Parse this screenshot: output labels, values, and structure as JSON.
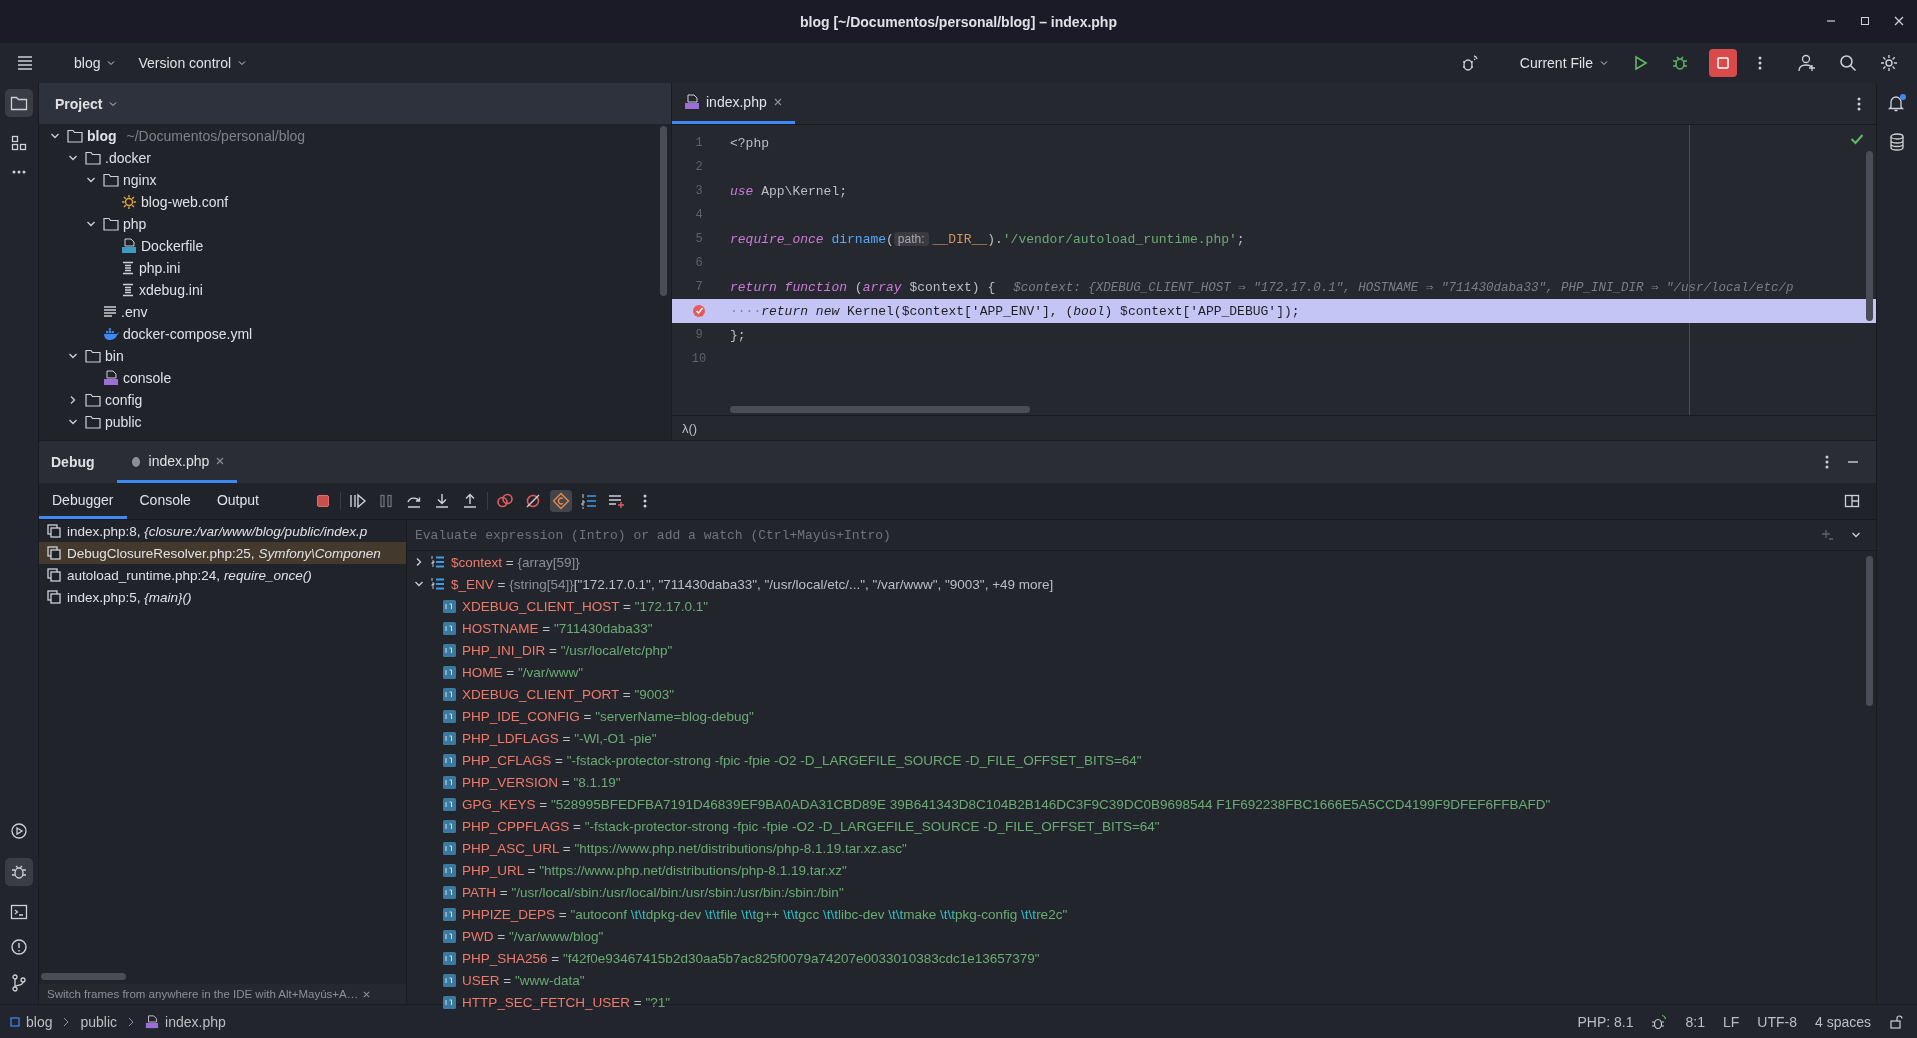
{
  "window": {
    "title": "blog [~/Documentos/personal/blog] – index.php"
  },
  "toolbar": {
    "project": "blog",
    "vcs": "Version control",
    "run_config": "Current File"
  },
  "project": {
    "title": "Project",
    "tree": [
      {
        "label": "blog",
        "path": "~/Documentos/personal/blog",
        "kind": "folder",
        "expanded": true,
        "children": [
          {
            "label": ".docker",
            "kind": "folder",
            "expanded": true,
            "children": [
              {
                "label": "nginx",
                "kind": "folder",
                "expanded": true,
                "children": [
                  {
                    "label": "blog-web.conf",
                    "kind": "config"
                  }
                ]
              },
              {
                "label": "php",
                "kind": "folder",
                "expanded": true,
                "children": [
                  {
                    "label": "Dockerfile",
                    "kind": "dockerfile"
                  },
                  {
                    "label": "php.ini",
                    "kind": "ini"
                  },
                  {
                    "label": "xdebug.ini",
                    "kind": "ini"
                  }
                ]
              },
              {
                "label": ".env",
                "kind": "text"
              },
              {
                "label": "docker-compose.yml",
                "kind": "compose"
              }
            ]
          },
          {
            "label": "bin",
            "kind": "folder",
            "expanded": true,
            "children": [
              {
                "label": "console",
                "kind": "php"
              }
            ]
          },
          {
            "label": "config",
            "kind": "folder",
            "expanded": false
          },
          {
            "label": "public",
            "kind": "folder",
            "expanded": true
          }
        ]
      }
    ]
  },
  "editor": {
    "tabs": [
      {
        "label": "index.php",
        "selected": true
      }
    ],
    "lines": [
      {
        "number": "1",
        "current": false,
        "breakpoint": false,
        "tokens": [
          {
            "kind": "plain",
            "text": "<?php"
          }
        ]
      },
      {
        "number": "2",
        "current": false,
        "breakpoint": false
      },
      {
        "number": "3",
        "current": false,
        "breakpoint": false,
        "tokens": [
          {
            "kind": "kw",
            "text": "use"
          },
          {
            "kind": "plain",
            "text": " App\\Kernel;"
          }
        ]
      },
      {
        "number": "4",
        "current": false,
        "breakpoint": false
      },
      {
        "number": "5",
        "current": false,
        "breakpoint": false,
        "tokens": [
          {
            "kind": "kw",
            "text": "require_once"
          },
          {
            "kind": "fn",
            "text": " dirname"
          },
          {
            "kind": "plain",
            "text": "("
          },
          {
            "kind": "hint",
            "text": "path:"
          },
          {
            "kind": "const",
            "text": "__DIR__"
          },
          {
            "kind": "plain",
            "text": ")."
          },
          {
            "kind": "str",
            "text": "'/vendor/autoload_runtime.php'"
          },
          {
            "kind": "plain",
            "text": ";"
          }
        ]
      },
      {
        "number": "6",
        "current": false,
        "breakpoint": false
      },
      {
        "number": "7",
        "current": false,
        "breakpoint": false,
        "tokens": [
          {
            "kind": "kw",
            "text": "return function"
          },
          {
            "kind": "plain",
            "text": " ("
          },
          {
            "kind": "kw",
            "text": "array"
          },
          {
            "kind": "plain",
            "text": " $context) {"
          },
          {
            "kind": "inline",
            "text": "$context: {XDEBUG_CLIENT_HOST ⇒ \"172.17.0.1\", HOSTNAME ⇒ \"711430daba33\", PHP_INI_DIR ⇒ \"/usr/local/etc/p"
          }
        ]
      },
      {
        "current": true,
        "breakpoint": true,
        "tokens": [
          {
            "kind": "ws",
            "text": "····"
          },
          {
            "kind": "kw",
            "text": "return new"
          },
          {
            "kind": "plain",
            "text": " Kernel($context['APP_ENV'], ("
          },
          {
            "kind": "kw",
            "text": "bool"
          },
          {
            "kind": "plain",
            "text": ") $context['APP_DEBUG']);"
          }
        ]
      },
      {
        "number": "9",
        "current": false,
        "breakpoint": false,
        "tokens": [
          {
            "kind": "plain",
            "text": "};"
          }
        ]
      },
      {
        "number": "10",
        "current": false,
        "breakpoint": false
      }
    ],
    "breadcrumb": "λ()"
  },
  "debug": {
    "title": "Debug",
    "tabs": [
      {
        "label": "index.php",
        "selected": true
      }
    ],
    "subtabs": [
      {
        "label": "Debugger",
        "selected": true
      },
      {
        "label": "Console",
        "selected": false
      },
      {
        "label": "Output",
        "selected": false
      }
    ],
    "actions": [
      {
        "kind": "stop",
        "on": false
      },
      {
        "kind": "resume",
        "on": false
      },
      {
        "kind": "pause",
        "on": false
      },
      {
        "kind": "step-over",
        "on": false
      },
      {
        "kind": "step-into",
        "on": false
      },
      {
        "kind": "step-out",
        "on": false
      },
      {
        "kind": "breakpoints",
        "on": false
      },
      {
        "kind": "mute",
        "on": false
      },
      {
        "kind": "exceptions",
        "on": true
      },
      {
        "kind": "frames",
        "on": false
      },
      {
        "kind": "watch",
        "on": false
      },
      {
        "kind": "more",
        "on": false
      }
    ],
    "frames": [
      {
        "text": "index.php:8, *{closure:/var/www/blog/public/index.p*",
        "selected": false
      },
      {
        "text": "DebugClosureResolver.php:25, *Symfony\\Componen*",
        "selected": true
      },
      {
        "text": "autoload_runtime.php:24, *require_once()*",
        "selected": false
      },
      {
        "text": "index.php:5, *{main}()*",
        "selected": false
      }
    ],
    "hint": "Switch frames from anywhere in the IDE with Alt+Mayús+A…",
    "evaluate": {
      "placeholder": "Evaluate expression (Intro) or add a watch (Ctrl+Mayús+Intro)"
    },
    "variables": [
      {
        "name": "$context",
        "op": "=",
        "type": "{array[59]}",
        "expanded": false
      },
      {
        "name": "$_ENV",
        "op": "=",
        "type": "{string[54]}",
        "value": "[\"172.17.0.1\", \"711430daba33\", \"/usr/local/etc/...\", \"/var/www\", \"9003\", +49 more]",
        "expanded": true,
        "children": [
          {
            "name": "XDEBUG_CLIENT_HOST",
            "op": "=",
            "value": "\"172.17.0.1\""
          },
          {
            "name": "HOSTNAME",
            "op": "=",
            "value": "\"711430daba33\""
          },
          {
            "name": "PHP_INI_DIR",
            "op": "=",
            "value": "\"/usr/local/etc/php\""
          },
          {
            "name": "HOME",
            "op": "=",
            "value": "\"/var/www\""
          },
          {
            "name": "XDEBUG_CLIENT_PORT",
            "op": "=",
            "value": "\"9003\""
          },
          {
            "name": "PHP_IDE_CONFIG",
            "op": "=",
            "value": "\"serverName=blog-debug\""
          },
          {
            "name": "PHP_LDFLAGS",
            "op": "=",
            "value": "\"-Wl,-O1 -pie\""
          },
          {
            "name": "PHP_CFLAGS",
            "op": "=",
            "value": "\"-fstack-protector-strong -fpic -fpie -O2 -D_LARGEFILE_SOURCE -D_FILE_OFFSET_BITS=64\""
          },
          {
            "name": "PHP_VERSION",
            "op": "=",
            "value": "\"8.1.19\""
          },
          {
            "name": "GPG_KEYS",
            "op": "=",
            "value": "\"528995BFEDFBA7191D46839EF9BA0ADA31CBD89E 39B641343D8C104B2B146DC3F9C39DC0B9698544 F1F692238FBC1666E5A5CCD4199F9DFEF6FFBAFD\""
          },
          {
            "name": "PHP_CPPFLAGS",
            "op": "=",
            "value": "\"-fstack-protector-strong -fpic -fpie -O2 -D_LARGEFILE_SOURCE -D_FILE_OFFSET_BITS=64\""
          },
          {
            "name": "PHP_ASC_URL",
            "op": "=",
            "value": "\"https://www.php.net/distributions/php-8.1.19.tar.xz.asc\""
          },
          {
            "name": "PHP_URL",
            "op": "=",
            "value": "\"https://www.php.net/distributions/php-8.1.19.tar.xz\""
          },
          {
            "name": "PATH",
            "op": "=",
            "value": "\"/usr/local/sbin:/usr/local/bin:/usr/sbin:/usr/bin:/sbin:/bin\""
          },
          {
            "name": "PHPIZE_DEPS",
            "op": "=",
            "parts": [
              {
                "text": "\"autoconf ",
                "escape": false
              },
              {
                "text": "\\t\\t",
                "escape": true
              },
              {
                "text": "dpkg-dev ",
                "escape": false
              },
              {
                "text": "\\t\\t",
                "escape": true
              },
              {
                "text": "file ",
                "escape": false
              },
              {
                "text": "\\t\\t",
                "escape": true
              },
              {
                "text": "g++ ",
                "escape": false
              },
              {
                "text": "\\t\\t",
                "escape": true
              },
              {
                "text": "gcc ",
                "escape": false
              },
              {
                "text": "\\t\\t",
                "escape": true
              },
              {
                "text": "libc-dev ",
                "escape": false
              },
              {
                "text": "\\t\\t",
                "escape": true
              },
              {
                "text": "make ",
                "escape": false
              },
              {
                "text": "\\t\\t",
                "escape": true
              },
              {
                "text": "pkg-config ",
                "escape": false
              },
              {
                "text": "\\t\\t",
                "escape": true
              },
              {
                "text": "re2c\"",
                "escape": false
              }
            ]
          },
          {
            "name": "PWD",
            "op": "=",
            "value": "\"/var/www/blog\""
          },
          {
            "name": "PHP_SHA256",
            "op": "=",
            "value": "\"f42f0e93467415b2d30aa5b7ac825f0079a74207e0033010383cdc1e13657379\""
          },
          {
            "name": "USER",
            "op": "=",
            "value": "\"www-data\""
          },
          {
            "name": "HTTP_SEC_FETCH_USER",
            "op": "=",
            "value": "\"?1\""
          }
        ]
      }
    ]
  },
  "status_bar": {
    "breadcrumbs": [
      "blog",
      "public",
      "index.php"
    ],
    "php": "PHP: 8.1",
    "position": "8:1",
    "line_endings": "LF",
    "encoding": "UTF-8",
    "indent": "4 spaces"
  }
}
